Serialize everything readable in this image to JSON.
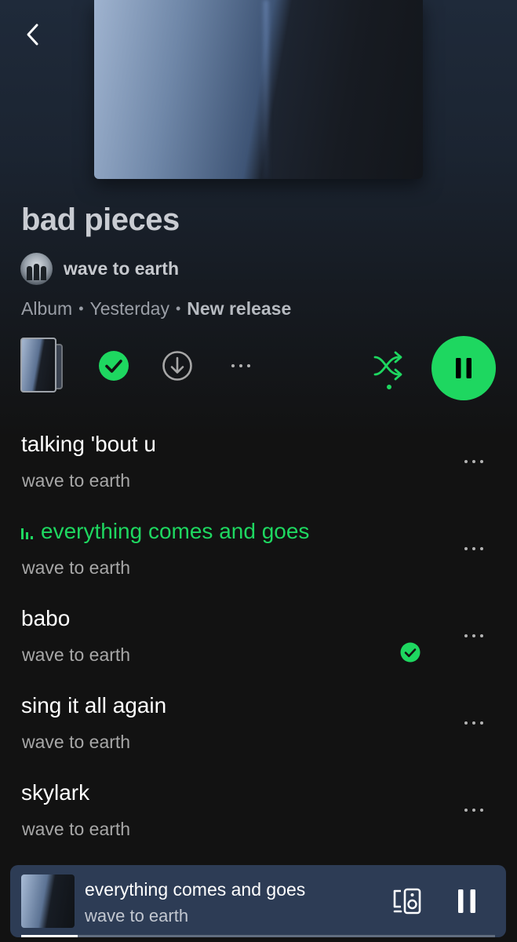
{
  "album": {
    "title": "bad pieces",
    "artist": "wave to earth",
    "type": "Album",
    "date": "Yesterday",
    "badge": "New release",
    "separator": "•"
  },
  "actions": {
    "saved": true,
    "thumb_icon": "album-stack-icon",
    "check_icon": "check-circle-icon",
    "download_icon": "download-icon",
    "more_icon": "more-icon",
    "shuffle_icon": "shuffle-icon",
    "shuffle_enabled": true,
    "play_state": "playing",
    "play_icon": "pause-icon"
  },
  "tracks": [
    {
      "title": "talking 'bout u",
      "artist": "wave to earth",
      "playing": false,
      "saved": false
    },
    {
      "title": "everything comes and goes",
      "artist": "wave to earth",
      "playing": true,
      "saved": false
    },
    {
      "title": "babo",
      "artist": "wave to earth",
      "playing": false,
      "saved": true
    },
    {
      "title": "sing it all again",
      "artist": "wave to earth",
      "playing": false,
      "saved": false
    },
    {
      "title": "skylark",
      "artist": "wave to earth",
      "playing": false,
      "saved": false
    }
  ],
  "now_playing": {
    "title": "everything comes and goes",
    "artist": "wave to earth",
    "progress": 0.12,
    "device_icon": "connect-device-icon",
    "pause_icon": "pause-icon"
  },
  "colors": {
    "accent": "#1ed760",
    "background": "#121212",
    "header": "#1f2a3a",
    "mini_player": "#2d3c55"
  }
}
